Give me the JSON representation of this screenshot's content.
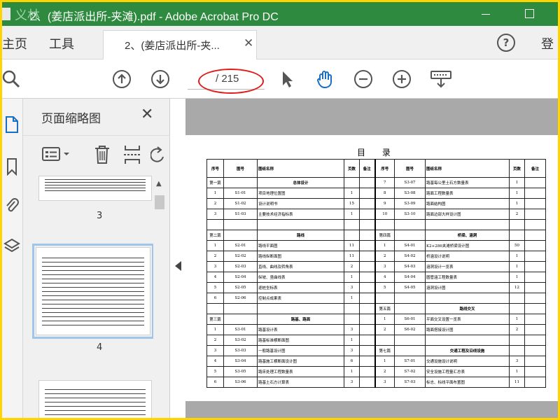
{
  "window": {
    "ghost_text": "义林",
    "title": "2、(姜店派出所-夹滩).pdf - Adobe Acrobat Pro DC"
  },
  "tabs": {
    "home": "主页",
    "tools": "工具",
    "doc": "2、(姜店派出所-夹...",
    "login": "登"
  },
  "toolbar": {
    "page_current": "",
    "page_total": "/ 215"
  },
  "annotation": {
    "color": "#e21a1a"
  },
  "thumb_panel": {
    "title": "页面缩略图",
    "pages": [
      "3",
      "4"
    ]
  },
  "doc": {
    "title": "目 录",
    "headers": [
      "序号",
      "图号",
      "图纸名称",
      "页数",
      "备注",
      "序号",
      "图号",
      "图纸名称",
      "页数",
      "备注"
    ],
    "rows": [
      [
        "第一篇",
        "",
        "总体设计",
        "",
        "",
        "7",
        "S3-07",
        "路基每公里土石方数量表",
        "1",
        ""
      ],
      [
        "1",
        "S1-01",
        "项目地理位置图",
        "1",
        "",
        "8",
        "S3-08",
        "路面工程数量表",
        "1",
        ""
      ],
      [
        "2",
        "S1-02",
        "设计说明书",
        "15",
        "",
        "9",
        "S3-09",
        "路面结构图",
        "1",
        ""
      ],
      [
        "3",
        "S1-03",
        "主要技术经济指标表",
        "1",
        "",
        "10",
        "S3-10",
        "路面边部大样设计图",
        "2",
        ""
      ],
      [
        "",
        "",
        "",
        "",
        "",
        "",
        "",
        "",
        "",
        ""
      ],
      [
        "第二篇",
        "",
        "路线",
        "",
        "",
        "第四篇",
        "",
        "桥梁、涵洞",
        "",
        ""
      ],
      [
        "1",
        "S2-01",
        "路线平面图",
        "11",
        "",
        "1",
        "S4-01",
        "K2+286夹滩桥梁设计图",
        "50",
        ""
      ],
      [
        "2",
        "S2-02",
        "路线纵断面图",
        "11",
        "",
        "2",
        "S4-02",
        "桥涵设计说明",
        "1",
        ""
      ],
      [
        "3",
        "S2-03",
        "直线、曲线及转角表",
        "2",
        "",
        "3",
        "S4-03",
        "涵洞设计一览表",
        "1",
        ""
      ],
      [
        "4",
        "S2-04",
        "纵坡、竖曲线表",
        "1",
        "",
        "4",
        "S4-04",
        "圆管涵工程数量表",
        "1",
        ""
      ],
      [
        "5",
        "S2-05",
        "逐桩坐标表",
        "3",
        "",
        "5",
        "S4-05",
        "涵洞设计图",
        "12",
        ""
      ],
      [
        "6",
        "S2-06",
        "控制点成果表",
        "1",
        "",
        "",
        "",
        "",
        "",
        ""
      ],
      [
        "",
        "",
        "",
        "",
        "",
        "第五篇",
        "",
        "路线交叉",
        "",
        ""
      ],
      [
        "第三篇",
        "",
        "路基、路面",
        "",
        "",
        "1",
        "S6-01",
        "平面交叉设置一览表",
        "1",
        ""
      ],
      [
        "1",
        "S3-01",
        "路基设计表",
        "3",
        "",
        "2",
        "S6-02",
        "路面搭接设计图",
        "2",
        ""
      ],
      [
        "2",
        "S3-02",
        "路基标准横断面图",
        "1",
        "",
        "",
        "",
        "",
        "",
        ""
      ],
      [
        "3",
        "S3-03",
        "一般路基设计图",
        "3",
        "",
        "第七篇",
        "",
        "交通工程及沿线设施",
        "",
        ""
      ],
      [
        "4",
        "S3-04",
        "路基施工横断面设计图",
        "6",
        "",
        "1",
        "S7-01",
        "交通设施设计说明",
        "3",
        ""
      ],
      [
        "5",
        "S3-05",
        "路床处理工程数量表",
        "1",
        "",
        "2",
        "S7-02",
        "安全设施工程量汇总表",
        "1",
        ""
      ],
      [
        "6",
        "S3-06",
        "路基土石方计算表",
        "3",
        "",
        "3",
        "S7-03",
        "标志、标线平面布置图",
        "11",
        ""
      ]
    ]
  }
}
